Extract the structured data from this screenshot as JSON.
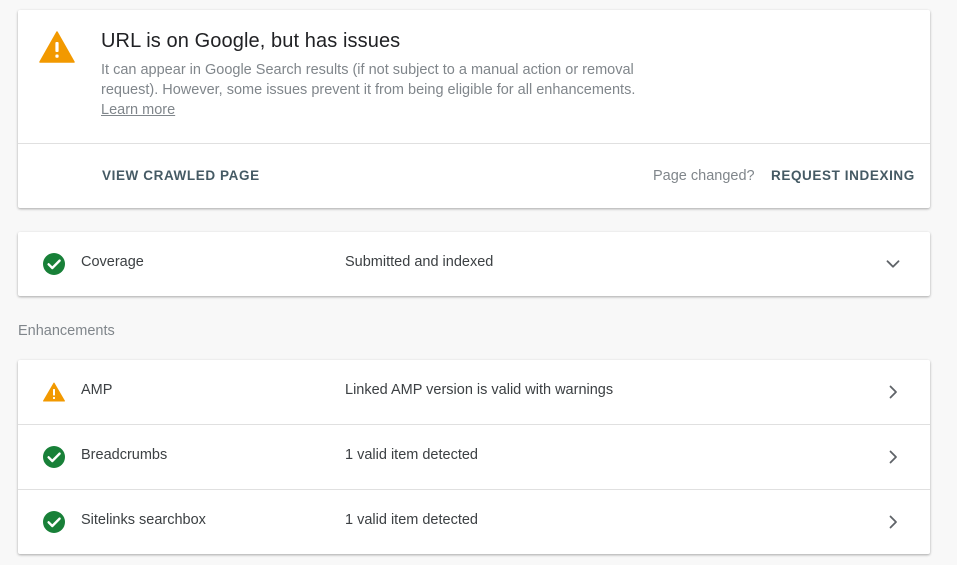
{
  "status": {
    "title": "URL is on Google, but has issues",
    "description": "It can appear in Google Search results (if not subject to a manual action or removal request). However, some issues prevent it from being eligible for all enhancements.",
    "learn_more": "Learn more",
    "view_crawled_label": "VIEW CRAWLED PAGE",
    "page_changed_text": "Page changed?",
    "request_indexing_label": "REQUEST INDEXING",
    "icon": "warning-icon"
  },
  "coverage": {
    "label": "Coverage",
    "value": "Submitted and indexed",
    "icon": "check-circle-icon"
  },
  "enhancements": {
    "section_title": "Enhancements",
    "items": [
      {
        "label": "AMP",
        "value": "Linked AMP version is valid with warnings",
        "icon": "warning-icon"
      },
      {
        "label": "Breadcrumbs",
        "value": "1 valid item detected",
        "icon": "check-circle-icon"
      },
      {
        "label": "Sitelinks searchbox",
        "value": "1 valid item detected",
        "icon": "check-circle-icon"
      }
    ]
  },
  "colors": {
    "warning": "#f29900",
    "valid": "#188038",
    "action_text": "#455a64"
  }
}
